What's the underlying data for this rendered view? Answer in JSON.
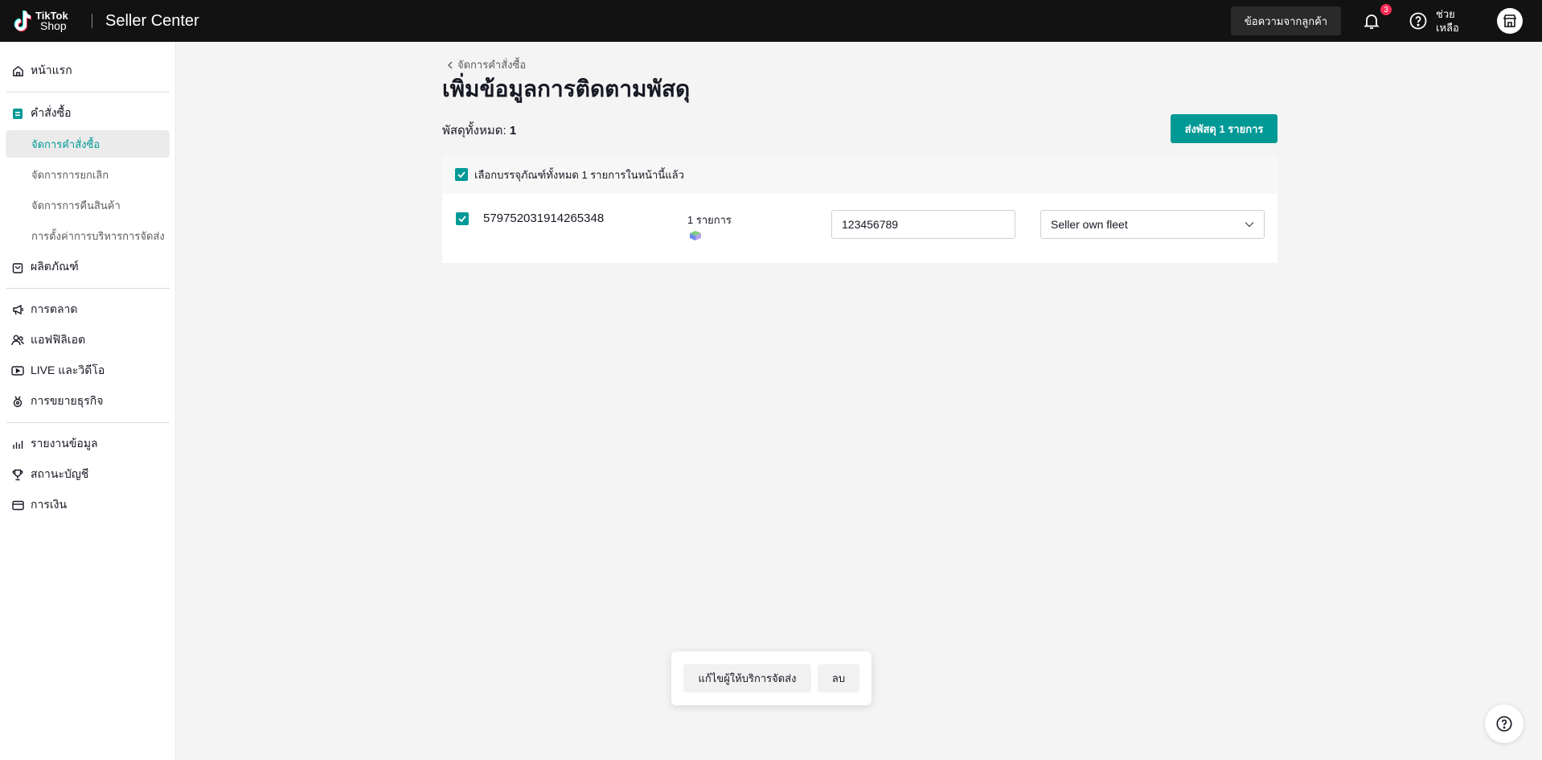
{
  "header": {
    "logo_line1": "TikTok",
    "logo_line2": "Shop",
    "app_title": "Seller Center",
    "messages_button": "ข้อความจากลูกค้า",
    "notification_count": "3",
    "help_label": "ช่วยเหลือ"
  },
  "sidebar": {
    "home": "หน้าแรก",
    "orders": "คำสั่งซื้อ",
    "orders_sub": [
      "จัดการคำสั่งซื้อ",
      "จัดการการยกเลิก",
      "จัดการการคืนสินค้า",
      "การตั้งค่าการบริหารการจัดส่ง"
    ],
    "products": "ผลิตภัณฑ์",
    "marketing": "การตลาด",
    "affiliate": "แอฟฟิลิเอต",
    "live_video": "LIVE และวิดีโอ",
    "growth": "การขยายธุรกิจ",
    "reports": "รายงานข้อมูล",
    "account_health": "สถานะบัญชี",
    "finance": "การเงิน"
  },
  "main": {
    "breadcrumb": "จัดการคำสั่งซื้อ",
    "title": "เพิ่มข้อมูลการติดตามพัสดุ",
    "total_label": "พัสดุทั้งหมด: ",
    "total_value": "1",
    "ship_button": "ส่งพัสดุ 1 รายการ",
    "select_all_label": "เลือกบรรจุภัณฑ์ทั้งหมด 1 รายการในหน้านี้แล้ว",
    "package": {
      "id": "579752031914265348",
      "items_label": "1 รายการ",
      "tracking_number": "123456789",
      "carrier": "Seller own fleet"
    }
  },
  "floating_bar": {
    "edit_carrier": "แก้ไขผู้ให้บริการจัดส่ง",
    "delete": "ลบ"
  },
  "colors": {
    "accent": "#009995",
    "topbar": "#121212",
    "badge": "#fe2c55"
  }
}
